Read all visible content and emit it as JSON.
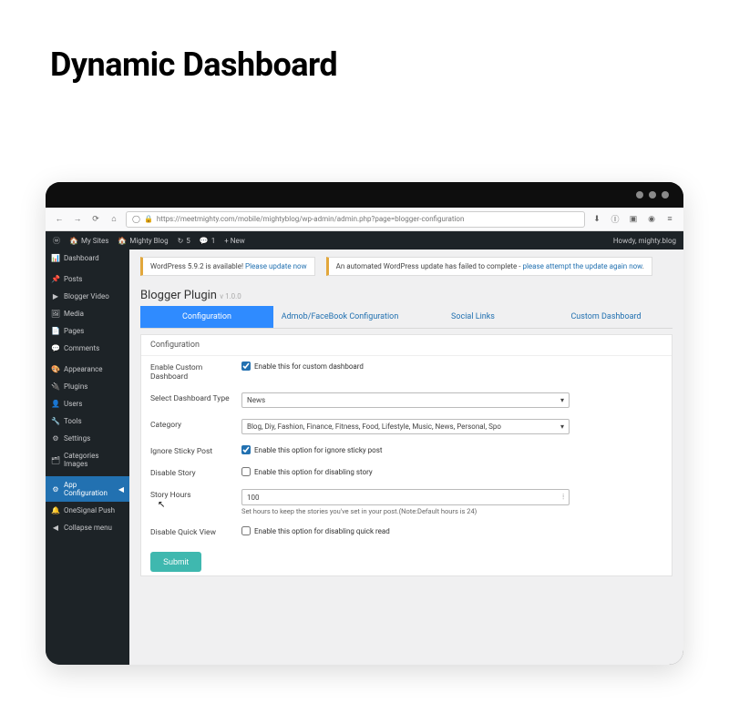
{
  "page_heading": "Dynamic Dashboard",
  "browser": {
    "url_display": "https://meetmighty.com/mobile/mightyblog/wp-admin/admin.php?page=blogger-configuration",
    "lock_label": "🔒"
  },
  "adminbar": {
    "mysites": "My Sites",
    "sitename": "Mighty Blog",
    "updates": "5",
    "comments": "1",
    "new": "+ New",
    "howdy": "Howdy, mighty.blog"
  },
  "sidebar": {
    "items": [
      {
        "icon": "📊",
        "label": "Dashboard"
      },
      {
        "icon": "📌",
        "label": "Posts"
      },
      {
        "icon": "▶",
        "label": "Blogger Video"
      },
      {
        "icon": "🖼",
        "label": "Media"
      },
      {
        "icon": "📄",
        "label": "Pages"
      },
      {
        "icon": "💬",
        "label": "Comments"
      },
      {
        "icon": "🎨",
        "label": "Appearance"
      },
      {
        "icon": "🔌",
        "label": "Plugins"
      },
      {
        "icon": "👤",
        "label": "Users"
      },
      {
        "icon": "🔧",
        "label": "Tools"
      },
      {
        "icon": "⚙",
        "label": "Settings"
      },
      {
        "icon": "🗂",
        "label": "Categories Images"
      },
      {
        "icon": "⚙",
        "label": "App Configuration"
      },
      {
        "icon": "🔔",
        "label": "OneSignal Push"
      },
      {
        "icon": "◀",
        "label": "Collapse menu"
      }
    ]
  },
  "notices": {
    "update_prefix": "WordPress 5.9.2 is available!",
    "update_link": "Please update now",
    "failed_prefix": "An automated WordPress update has failed to complete -",
    "failed_link": "please attempt the update again now"
  },
  "plugin": {
    "title": "Blogger Plugin",
    "version": "v 1.0.0"
  },
  "tabs": {
    "t1": "Configuration",
    "t2": "Admob/FaceBook Configuration",
    "t3": "Social Links",
    "t4": "Custom Dashboard"
  },
  "panel": {
    "heading": "Configuration",
    "fields": {
      "enable_custom": {
        "label": "Enable Custom Dashboard",
        "checkbox_label": "Enable this for custom dashboard",
        "checked": true
      },
      "dashboard_type": {
        "label": "Select Dashboard Type",
        "value": "News"
      },
      "category": {
        "label": "Category",
        "value": "Blog, Diy, Fashion, Finance, Fitness, Food, Lifestyle, Music, News, Personal, Spo"
      },
      "ignore_sticky": {
        "label": "Ignore Sticky Post",
        "checkbox_label": "Enable this option for ignore sticky post",
        "checked": true
      },
      "disable_story": {
        "label": "Disable Story",
        "checkbox_label": "Enable this option for disabling story",
        "checked": false
      },
      "story_hours": {
        "label": "Story Hours",
        "value": "100",
        "help": "Set hours to keep the stories you've set in your post.(Note:Default hours is 24)"
      },
      "disable_quick": {
        "label": "Disable Quick View",
        "checkbox_label": "Enable this option for disabling quick read",
        "checked": false
      }
    },
    "submit": "Submit"
  }
}
